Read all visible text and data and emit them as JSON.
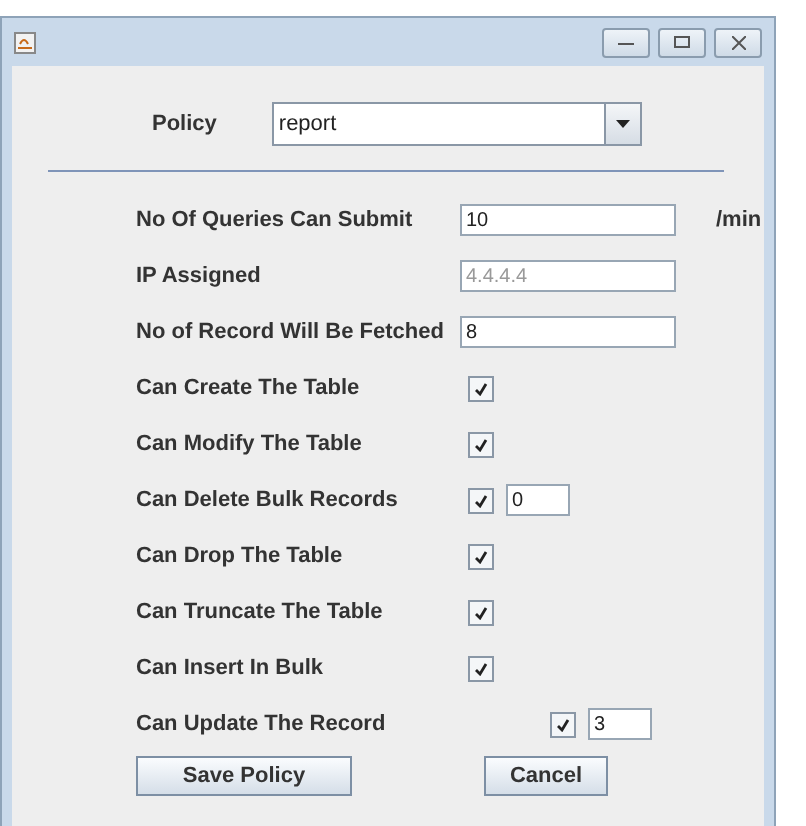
{
  "policy": {
    "label": "Policy",
    "value": "report"
  },
  "rows": [
    {
      "kind": "text",
      "label": "No Of Queries Can Submit",
      "value": "10",
      "unit": "/min",
      "disabled": false
    },
    {
      "kind": "text",
      "label": "IP Assigned",
      "value": "4.4.4.4",
      "disabled": true
    },
    {
      "kind": "text",
      "label": "No of Record Will Be Fetched",
      "value": "8",
      "disabled": false
    },
    {
      "kind": "check",
      "label": "Can Create The Table",
      "checked": true
    },
    {
      "kind": "check",
      "label": "Can Modify The Table",
      "checked": true
    },
    {
      "kind": "check-count",
      "label": "Can Delete Bulk Records",
      "checked": true,
      "value": "0"
    },
    {
      "kind": "check",
      "label": "Can Drop The Table",
      "checked": true
    },
    {
      "kind": "check",
      "label": "Can Truncate The Table",
      "checked": true
    },
    {
      "kind": "check",
      "label": "Can Insert In Bulk",
      "checked": true
    },
    {
      "kind": "shifted-check-count",
      "label": "Can Update The Record",
      "checked": true,
      "value": "3"
    }
  ],
  "buttons": [
    "Save Policy",
    "Cancel"
  ]
}
